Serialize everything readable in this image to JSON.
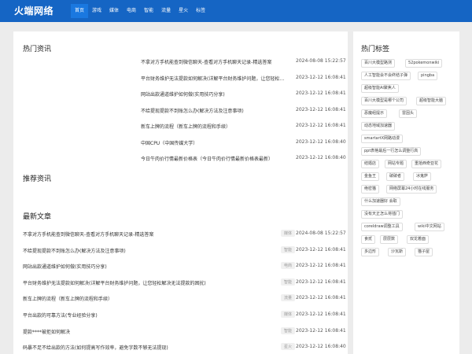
{
  "site": {
    "logo": "火端网络"
  },
  "nav": [
    {
      "label": "首页",
      "active": true
    },
    {
      "label": "游戏"
    },
    {
      "label": "媒体"
    },
    {
      "label": "电商"
    },
    {
      "label": "智能"
    },
    {
      "label": "流量"
    },
    {
      "label": "星火"
    },
    {
      "label": "标签"
    }
  ],
  "hot": {
    "title": "热门资讯",
    "items": [
      {
        "title": "不拿对方手机能查到微信聊天-查看对方手机聊天记录-精选答案",
        "date": "2024-08-08 15:22:57"
      },
      {
        "title": "平台财务维护无法提款如何解决(详解平台财务维护问题，让您轻松…",
        "date": "2023-12-12 16:08:41"
      },
      {
        "title": "网站出款通道维护如何做(实用技巧分享)",
        "date": "2023-12-12 16:08:41"
      },
      {
        "title": "不给提现提款不到账怎么办(解决方法及注意事项)",
        "date": "2023-12-12 16:08:41"
      },
      {
        "title": "新车上牌的流程（新车上牌的流程和手续）",
        "date": "2023-12-12 16:08:41"
      },
      {
        "title": "中国CPU（中国传媒大学）",
        "date": "2023-12-12 16:08:40"
      },
      {
        "title": "今日牛肉价行情最新价格表（今日牛肉价行情最新价格表最新）",
        "date": "2023-12-12 16:08:40"
      }
    ]
  },
  "recommend": {
    "title": "推荐资讯"
  },
  "latest": {
    "title": "最新文章",
    "items": [
      {
        "title": "不拿对方手机能查到微信聊天-查看对方手机聊天记录-精选答案",
        "badge": "媒体",
        "date": "2024-08-08 15:22:57"
      },
      {
        "title": "不给提现提款不到账怎么办(解决方法及注意事项)",
        "badge": "智能",
        "date": "2023-12-12 16:08:41"
      },
      {
        "title": "网站出款通道维护如何做(实用技巧分享)",
        "badge": "电商",
        "date": "2023-12-12 16:08:41"
      },
      {
        "title": "平台财务维护无法提款如何解决(详解平台财务维护问题，让您轻松解决无法提款的困扰)",
        "badge": "智能",
        "date": "2023-12-12 16:08:41"
      },
      {
        "title": "新车上牌的流程（新车上牌的流程和手续）",
        "badge": "流量",
        "date": "2023-12-12 16:08:41"
      },
      {
        "title": "平台出款的可靠方法(专业经验分享)",
        "badge": "媒体",
        "date": "2023-12-12 16:08:41"
      },
      {
        "title": "提款****被拒如何解决",
        "badge": "智能",
        "date": "2023-12-12 16:08:41"
      },
      {
        "title": "码暴不足不给出款的方法(如何提高写作效率，避免字数不够无法提现)",
        "badge": "星火",
        "date": "2023-12-12 16:08:40"
      }
    ]
  },
  "sidebar": {
    "title": "热门标签",
    "tags": [
      "百川大模型路测",
      "52pokemonwiki",
      "人工智能会不会终结子弹",
      "pingba",
      "超级智能AI聚焦人",
      "百川大模型是哪个公司",
      "超级智能大脑",
      "恶魔组提示",
      "雷因头",
      "动态地域加速器",
      "smartartX网路动漫",
      "ppt表格最后一行怎么调整行高",
      "结婚店",
      "网站专题",
      "重拾西奇亚花",
      "金鱼王",
      "破破者",
      "冰鬼萨",
      "绝密猫",
      "网络屏幕24小时在线服务",
      "什么加速器好 会取",
      "没有天正怎么将插门",
      "coreldraw调整工具",
      "wiki中文网站",
      "食贰",
      "层层数",
      "双龙着面",
      "多边形",
      "沙瓦斯",
      "猫子屋"
    ]
  }
}
